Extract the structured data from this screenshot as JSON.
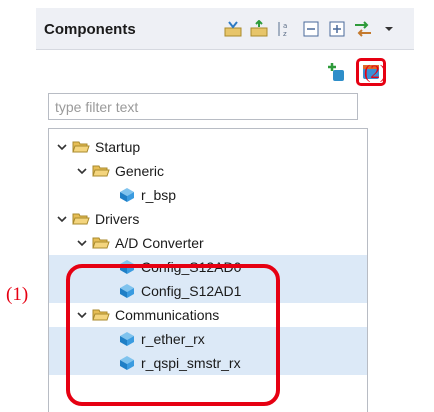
{
  "panel": {
    "title": "Components",
    "toolbar_icons": [
      "import-components-icon",
      "export-components-icon",
      "sort-az-icon",
      "collapse-all-icon",
      "expand-all-icon",
      "filter-arrows-icon",
      "view-menu-chevron-icon"
    ]
  },
  "actions": {
    "add_icon": "add-component-icon",
    "import_icon": "import-component-icon"
  },
  "filter": {
    "placeholder": "type filter text"
  },
  "tree": {
    "rows": [
      {
        "label": "Startup",
        "level": 0,
        "type": "folder",
        "expanded": true,
        "selected": false
      },
      {
        "label": "Generic",
        "level": 1,
        "type": "folder",
        "expanded": true,
        "selected": false
      },
      {
        "label": "r_bsp",
        "level": 2,
        "type": "component",
        "selected": false
      },
      {
        "label": "Drivers",
        "level": 0,
        "type": "folder",
        "expanded": true,
        "selected": false
      },
      {
        "label": "A/D Converter",
        "level": 1,
        "type": "folder",
        "expanded": true,
        "selected": false
      },
      {
        "label": "Config_S12AD0",
        "level": 2,
        "type": "component",
        "selected": true
      },
      {
        "label": "Config_S12AD1",
        "level": 2,
        "type": "component",
        "selected": true
      },
      {
        "label": "Communications",
        "level": 1,
        "type": "folder",
        "expanded": true,
        "selected": false
      },
      {
        "label": "r_ether_rx",
        "level": 2,
        "type": "component",
        "selected": true
      },
      {
        "label": "r_qspi_smstr_rx",
        "level": 2,
        "type": "component",
        "selected": true
      }
    ]
  },
  "annotations": {
    "label_1": "(1)",
    "label_2": "(2)",
    "color": "#e60012"
  }
}
